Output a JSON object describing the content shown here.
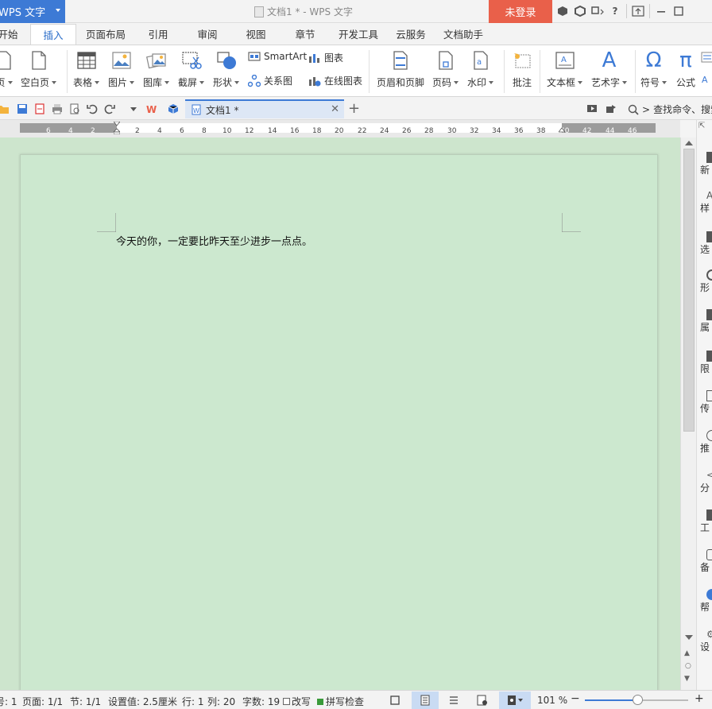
{
  "titlebar": {
    "app_button": "WPS 文字",
    "window_title": "文档1 * - WPS 文字",
    "login_button": "未登录",
    "help": "?"
  },
  "menu": {
    "tabs": [
      {
        "label": "开始"
      },
      {
        "label": "插入",
        "active": true
      },
      {
        "label": "页面布局"
      },
      {
        "label": "引用"
      },
      {
        "label": "审阅"
      },
      {
        "label": "视图"
      },
      {
        "label": "章节"
      },
      {
        "label": "开发工具"
      },
      {
        "label": "云服务"
      },
      {
        "label": "文档助手"
      }
    ]
  },
  "ribbon": {
    "page": "页",
    "blank_page": "空白页",
    "table": "表格",
    "picture": "图片",
    "gallery": "图库",
    "screenshot": "截屏",
    "shape": "形状",
    "smartart": "SmartArt",
    "chart": "图表",
    "relation_chart": "关系图",
    "online_chart": "在线图表",
    "header_footer": "页眉和页脚",
    "page_number": "页码",
    "watermark": "水印",
    "comment": "批注",
    "textbox": "文本框",
    "wordart": "艺术字",
    "symbol": "符号",
    "formula": "公式",
    "omega": "Ω",
    "pi": "π",
    "wordart_glyph": "A"
  },
  "quickbar": {
    "doc_tab": "文档1 *",
    "search_label": "查找命令、搜索"
  },
  "ruler": {
    "left_numbers": [
      "6",
      "4",
      "2"
    ],
    "right_numbers": [
      "2",
      "4",
      "6",
      "8",
      "10",
      "12",
      "14",
      "16",
      "18",
      "20",
      "22",
      "24",
      "26",
      "28",
      "30",
      "32",
      "34",
      "36",
      "38",
      "40",
      "42",
      "44",
      "46"
    ]
  },
  "document": {
    "text": "今天的你，一定要比昨天至少进步一点点。"
  },
  "sidepanel": {
    "items": [
      "新",
      "样",
      "选",
      "形",
      "属",
      "限",
      "传",
      "推",
      "分",
      "工",
      "备",
      "帮",
      "设"
    ]
  },
  "statusbar": {
    "page_num": "号: 1",
    "pages": "页面: 1/1",
    "section": "节: 1/1",
    "setting": "设置值: 2.5厘米",
    "row": "行: 1",
    "col": "列: 20",
    "word_count": "字数: 19",
    "revise": "改写",
    "spell_check": "拼写检查",
    "zoom": "101 %",
    "zoom_level": 0.5
  },
  "colors": {
    "accent": "#3d7ad5",
    "login": "#e9604a",
    "doc_bg": "#cce8cf"
  }
}
